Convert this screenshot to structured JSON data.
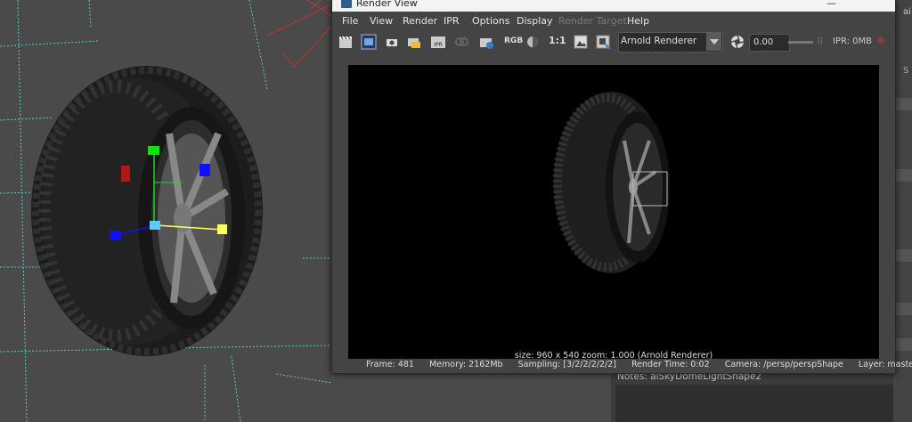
{
  "window": {
    "title": "Render View",
    "corner_button": "—"
  },
  "menu": [
    "File",
    "View",
    "Render",
    "IPR",
    "Options",
    "Display",
    "Render Target",
    "Help"
  ],
  "toolbar": {
    "rgb_label": "RGB",
    "one_to_one": "1:1",
    "renderer": "Arnold Renderer",
    "exposure": "0.00",
    "pause": "||",
    "ipr_memory": "IPR: 0MB"
  },
  "render": {
    "info": "size: 960 x 540 zoom: 1.000     (Arnold Renderer)",
    "frame": "Frame: 481",
    "memory": "Memory: 2162Mb",
    "sampling": "Sampling: [3/2/2/2/2/2]",
    "render_time": "Render Time: 0:02",
    "camera": "Camera: /persp/perspShape",
    "layer": "Layer: masterLayer"
  },
  "attribute_editor": {
    "notes": "Notes:  aiSkyDomeLightShape2",
    "side_top": "ai",
    "side_mid": "S"
  },
  "colors": {
    "viewport_bg": "#4a4a4a",
    "grid_line": "#5fc7c7",
    "camera_line": "#c83030",
    "manipulator_blue": "#1010ff",
    "manipulator_green": "#10e010",
    "manipulator_yellow": "#ffff60",
    "manipulator_red": "#b01818",
    "manipulator_cyan": "#60c8ff"
  }
}
